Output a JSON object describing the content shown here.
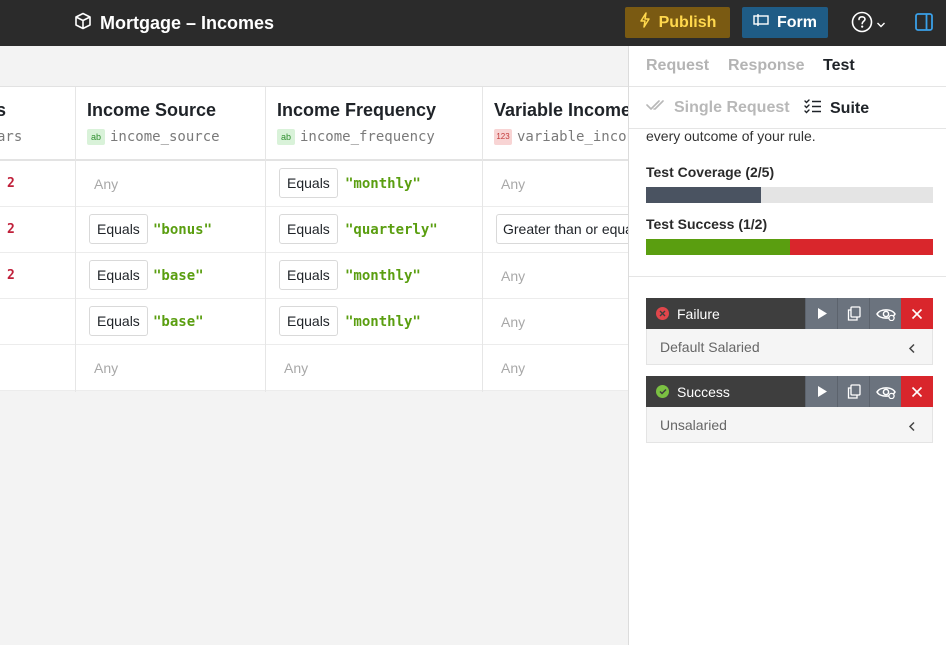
{
  "header": {
    "title": "Mortgage – Incomes",
    "publish_label": "Publish",
    "form_label": "Form"
  },
  "columns": [
    {
      "title": "s",
      "key": "ars",
      "type": ""
    },
    {
      "title": "Income Source",
      "key": "income_source",
      "type": "ab"
    },
    {
      "title": "Income Frequency",
      "key": "income_frequency",
      "type": "ab"
    },
    {
      "title": "Variable Income",
      "key": "variable_incon",
      "type": "123"
    }
  ],
  "rows": [
    {
      "c0": "2",
      "c1_op": "",
      "c1_val": "Any",
      "c2_op": "Equals",
      "c2_val": "\"monthly\"",
      "c3": "Any"
    },
    {
      "c0": "2",
      "c1_op": "Equals",
      "c1_val": "\"bonus\"",
      "c2_op": "Equals",
      "c2_val": "\"quarterly\"",
      "c3": "Greater than or equa"
    },
    {
      "c0": "2",
      "c1_op": "Equals",
      "c1_val": "\"base\"",
      "c2_op": "Equals",
      "c2_val": "\"monthly\"",
      "c3": "Any"
    },
    {
      "c0": "",
      "c1_op": "Equals",
      "c1_val": "\"base\"",
      "c2_op": "Equals",
      "c2_val": "\"monthly\"",
      "c3": "Any"
    },
    {
      "c0": "",
      "c1_op": "",
      "c1_val": "Any",
      "c2_op": "",
      "c2_val": "Any",
      "c3": "Any"
    }
  ],
  "panel": {
    "tabs": [
      "Request",
      "Response",
      "Test"
    ],
    "active_tab": "Test",
    "subtabs": [
      "Single Request",
      "Suite"
    ],
    "active_subtab": "Suite",
    "intro_tail": "every outcome of your rule.",
    "coverage_label": "Test Coverage (2/5)",
    "coverage_fraction": 0.4,
    "success_label": "Test Success (1/2)",
    "success_fraction": 0.5,
    "colors": {
      "coverage": "#4a5361",
      "success": "#5a9e10",
      "failure": "#d9262c",
      "bar_bg": "#e4e4e4"
    },
    "cases": [
      {
        "status": "Failure",
        "status_icon": "x-circle-icon",
        "description": "Default Salaried"
      },
      {
        "status": "Success",
        "status_icon": "check-circle-icon",
        "description": "Unsalaried"
      }
    ]
  }
}
